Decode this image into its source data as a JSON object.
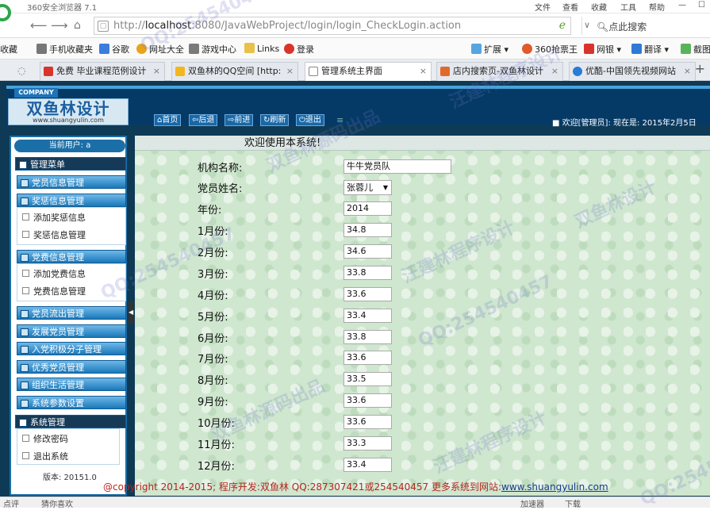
{
  "browser": {
    "title": "360安全浏览器 7.1",
    "menu": [
      "文件",
      "查看",
      "收藏",
      "工具",
      "帮助"
    ],
    "url_prefix": "http://",
    "url_host": "localhost",
    "url_rest": ":8080/JavaWebProject/login/login_CheckLogin.action",
    "search_placeholder": "点此搜索"
  },
  "favorites": {
    "left_label": "收藏",
    "items": [
      "手机收藏夹",
      "谷歌",
      "网址大全",
      "游戏中心",
      "Links",
      "登录"
    ],
    "right_items": [
      "扩展",
      "360抢票王",
      "网银",
      "翻译",
      "截图"
    ]
  },
  "tabs": [
    {
      "label": "免费 毕业课程范例设计",
      "color": "#d9342b"
    },
    {
      "label": "双鱼林的QQ空间 [http:",
      "color": "#f2b61f"
    },
    {
      "label": "管理系统主界面",
      "color": "#ffffff"
    },
    {
      "label": "店内搜索页-双鱼林设计",
      "color": "#e06a2a"
    },
    {
      "label": "优酷-中国领先视频网站",
      "color": "#2a7bd4"
    }
  ],
  "header": {
    "company": "COMPANY",
    "brand": "双鱼林设计",
    "brand_url": "www.shuangyulin.com",
    "buttons": [
      "首页",
      "后退",
      "前进",
      "刷新",
      "退出"
    ],
    "greeting": "欢迎[管理员]:    现在是: 2015年2月5日"
  },
  "sidebar": {
    "current_user_label": "当前用户: a",
    "menu_title": "管理菜单",
    "groups": [
      {
        "label": "党员信息管理"
      },
      {
        "label": "奖惩信息管理",
        "children": [
          "添加奖惩信息",
          "奖惩信息管理"
        ]
      },
      {
        "label": "党费信息管理",
        "children": [
          "添加党费信息",
          "党费信息管理"
        ]
      },
      {
        "label": "党员流出管理"
      },
      {
        "label": "发展党员管理"
      },
      {
        "label": "入党积极分子管理"
      },
      {
        "label": "优秀党员管理"
      },
      {
        "label": "组织生活管理"
      },
      {
        "label": "系统参数设置"
      }
    ],
    "system": {
      "label": "系统管理",
      "children": [
        "修改密码",
        "退出系统"
      ]
    },
    "version": "版本: 20151.0"
  },
  "main": {
    "welcome": "欢迎使用本系统!",
    "fields": {
      "org_label": "机构名称:",
      "org_value": "牛牛党员队",
      "member_label": "党员姓名:",
      "member_value": "张蓉儿",
      "year_label": "年份:",
      "year_value": "2014"
    },
    "months": [
      {
        "label": "1月份:",
        "value": "34.8"
      },
      {
        "label": "2月份:",
        "value": "34.6"
      },
      {
        "label": "3月份:",
        "value": "33.8"
      },
      {
        "label": "4月份:",
        "value": "33.6"
      },
      {
        "label": "5月份:",
        "value": "33.4"
      },
      {
        "label": "6月份:",
        "value": "33.8"
      },
      {
        "label": "7月份:",
        "value": "33.6"
      },
      {
        "label": "8月份:",
        "value": "33.5"
      },
      {
        "label": "9月份:",
        "value": "33.6"
      },
      {
        "label": "10月份:",
        "value": "33.6"
      },
      {
        "label": "11月份:",
        "value": "33.3"
      },
      {
        "label": "12月份:",
        "value": "33.4"
      }
    ]
  },
  "footer": {
    "text": "@copyright 2014-2015; 程序开发:双鱼林  QQ:287307421或254540457  更多系统到网站:",
    "link": "www.shuangyulin.com"
  },
  "statusbar": {
    "left": "点评",
    "guess": "猜你喜欢",
    "right": [
      "加速器",
      "下载"
    ]
  },
  "watermarks": [
    "QQ:254540457",
    "双鱼林源码出品",
    "汪建林程序设计",
    "双鱼林设计",
    "QQ:254540457",
    "汪建林程序设计",
    "双鱼林源码出品",
    "QQ:254540457",
    "汪建林程序设计",
    "QQ:254540457"
  ]
}
